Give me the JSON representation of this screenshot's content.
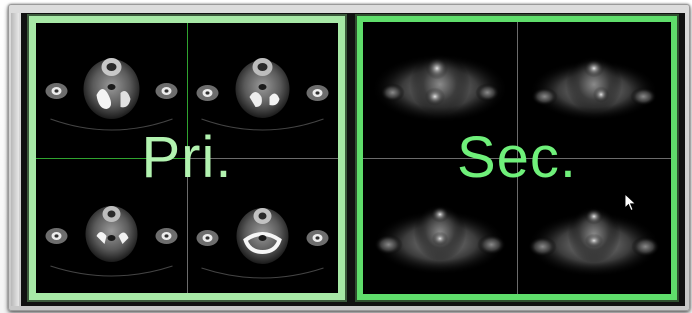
{
  "viewer": {
    "panels": [
      {
        "id": "primary",
        "label": "Pri.",
        "border_color": "#a7e8a6",
        "label_color": "#b2f3b0",
        "modality_look": "ct",
        "crosshair_color": "#2fa32f",
        "quadrants": 4
      },
      {
        "id": "secondary",
        "label": "Sec.",
        "border_color": "#5fde6b",
        "label_color": "#6ff07a",
        "modality_look": "pet",
        "quadrants": 4
      }
    ],
    "divider_color": "#6b6b6b",
    "cursor_icon": "arrow-pointer-icon"
  }
}
